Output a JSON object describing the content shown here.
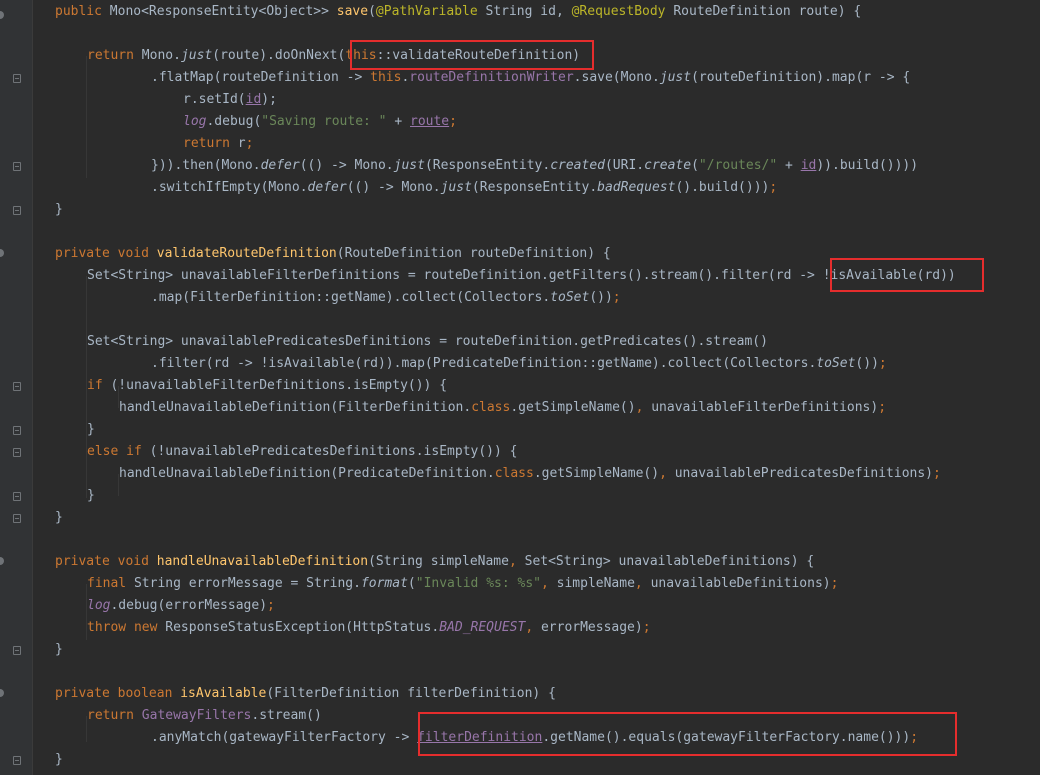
{
  "editor": {
    "language": "java",
    "lines": [
      [
        [
          "k",
          "public "
        ],
        [
          "d",
          "Mono<ResponseEntity<Object>> "
        ],
        [
          "f",
          "save"
        ],
        [
          "d",
          "("
        ],
        [
          "a",
          "@PathVariable "
        ],
        [
          "d",
          "String id, "
        ],
        [
          "a",
          "@RequestBody "
        ],
        [
          "d",
          "RouteDefinition route) {"
        ]
      ],
      [],
      [
        [
          "k",
          "return "
        ],
        [
          "d",
          "Mono."
        ],
        [
          "it",
          "just"
        ],
        [
          "d",
          "(route).doOnNext("
        ],
        [
          "k",
          "this"
        ],
        [
          "d",
          "::validateRouteDefinition)"
        ]
      ],
      [
        [
          "d",
          ".flatMap(routeDefinition -> "
        ],
        [
          "k",
          "this"
        ],
        [
          "d",
          "."
        ],
        [
          "p",
          "routeDefinitionWriter"
        ],
        [
          "d",
          ".save(Mono."
        ],
        [
          "it",
          "just"
        ],
        [
          "d",
          "(routeDefinition).map(r -> {"
        ]
      ],
      [
        [
          "d",
          "r.setId("
        ],
        [
          "pu",
          "id"
        ],
        [
          "d",
          ");"
        ]
      ],
      [
        [
          "ip",
          "log"
        ],
        [
          "d",
          ".debug("
        ],
        [
          "s",
          "\"Saving route: \""
        ],
        [
          "d",
          " + "
        ],
        [
          "pu",
          "route"
        ],
        [
          "k",
          ";"
        ]
      ],
      [
        [
          "k",
          "return "
        ],
        [
          "d",
          "r"
        ],
        [
          "k",
          ";"
        ]
      ],
      [
        [
          "d",
          "})).then(Mono."
        ],
        [
          "it",
          "defer"
        ],
        [
          "d",
          "(() -> Mono."
        ],
        [
          "it",
          "just"
        ],
        [
          "d",
          "(ResponseEntity."
        ],
        [
          "it",
          "created"
        ],
        [
          "d",
          "(URI."
        ],
        [
          "it",
          "create"
        ],
        [
          "d",
          "("
        ],
        [
          "s",
          "\"/routes/\""
        ],
        [
          "d",
          " + "
        ],
        [
          "pu",
          "id"
        ],
        [
          "d",
          ")).build())))"
        ]
      ],
      [
        [
          "d",
          ".switchIfEmpty(Mono."
        ],
        [
          "it",
          "defer"
        ],
        [
          "d",
          "(() -> Mono."
        ],
        [
          "it",
          "just"
        ],
        [
          "d",
          "(ResponseEntity."
        ],
        [
          "it",
          "badRequest"
        ],
        [
          "d",
          "().build()))"
        ],
        [
          "k",
          ";"
        ]
      ],
      [
        [
          "d",
          "}"
        ]
      ],
      [],
      [
        [
          "k",
          "private void "
        ],
        [
          "f",
          "validateRouteDefinition"
        ],
        [
          "d",
          "(RouteDefinition routeDefinition) {"
        ]
      ],
      [
        [
          "d",
          "Set<String> unavailableFilterDefinitions = routeDefinition.getFilters().stream().filter(rd -> !isAvailable(rd))"
        ]
      ],
      [
        [
          "d",
          ".map(FilterDefinition::getName).collect(Collectors."
        ],
        [
          "it",
          "toSet"
        ],
        [
          "d",
          "())"
        ],
        [
          "k",
          ";"
        ]
      ],
      [],
      [
        [
          "d",
          "Set<String> unavailablePredicatesDefinitions = routeDefinition.getPredicates().stream()"
        ]
      ],
      [
        [
          "d",
          ".filter(rd -> !isAvailable(rd)).map(PredicateDefinition::getName).collect(Collectors."
        ],
        [
          "it",
          "toSet"
        ],
        [
          "d",
          "())"
        ],
        [
          "k",
          ";"
        ]
      ],
      [
        [
          "k",
          "if "
        ],
        [
          "d",
          "(!unavailableFilterDefinitions.isEmpty()) {"
        ]
      ],
      [
        [
          "d",
          "handleUnavailableDefinition(FilterDefinition."
        ],
        [
          "k",
          "class"
        ],
        [
          "d",
          ".getSimpleName()"
        ],
        [
          "k",
          ", "
        ],
        [
          "d",
          "unavailableFilterDefinitions)"
        ],
        [
          "k",
          ";"
        ]
      ],
      [
        [
          "d",
          "}"
        ]
      ],
      [
        [
          "k",
          "else if "
        ],
        [
          "d",
          "(!unavailablePredicatesDefinitions.isEmpty()) {"
        ]
      ],
      [
        [
          "d",
          "handleUnavailableDefinition(PredicateDefinition."
        ],
        [
          "k",
          "class"
        ],
        [
          "d",
          ".getSimpleName()"
        ],
        [
          "k",
          ", "
        ],
        [
          "d",
          "unavailablePredicatesDefinitions)"
        ],
        [
          "k",
          ";"
        ]
      ],
      [
        [
          "d",
          "}"
        ]
      ],
      [
        [
          "d",
          "}"
        ]
      ],
      [],
      [
        [
          "k",
          "private void "
        ],
        [
          "f",
          "handleUnavailableDefinition"
        ],
        [
          "d",
          "(String simpleName"
        ],
        [
          "k",
          ", "
        ],
        [
          "d",
          "Set<String> unavailableDefinitions) {"
        ]
      ],
      [
        [
          "k",
          "final "
        ],
        [
          "d",
          "String errorMessage = String."
        ],
        [
          "it",
          "format"
        ],
        [
          "d",
          "("
        ],
        [
          "s",
          "\"Invalid %s: %s\""
        ],
        [
          "k",
          ", "
        ],
        [
          "d",
          "simpleName"
        ],
        [
          "k",
          ", "
        ],
        [
          "d",
          "unavailableDefinitions)"
        ],
        [
          "k",
          ";"
        ]
      ],
      [
        [
          "ip",
          "log"
        ],
        [
          "d",
          ".debug(errorMessage)"
        ],
        [
          "k",
          ";"
        ]
      ],
      [
        [
          "k",
          "throw new "
        ],
        [
          "d",
          "ResponseStatusException(HttpStatus."
        ],
        [
          "ip",
          "BAD_REQUEST"
        ],
        [
          "k",
          ", "
        ],
        [
          "d",
          "errorMessage)"
        ],
        [
          "k",
          ";"
        ]
      ],
      [
        [
          "d",
          "}"
        ]
      ],
      [],
      [
        [
          "k",
          "private boolean "
        ],
        [
          "f",
          "isAvailable"
        ],
        [
          "d",
          "(FilterDefinition filterDefinition) {"
        ]
      ],
      [
        [
          "k",
          "return "
        ],
        [
          "p",
          "GatewayFilters"
        ],
        [
          "d",
          ".stream()"
        ]
      ],
      [
        [
          "d",
          ".anyMatch(gatewayFilterFactory -> "
        ],
        [
          "pu",
          "filterDefinition"
        ],
        [
          "d",
          ".getName().equals(gatewayFilterFactory.name()))"
        ],
        [
          "k",
          ";"
        ]
      ],
      [
        [
          "d",
          "}"
        ]
      ]
    ]
  }
}
